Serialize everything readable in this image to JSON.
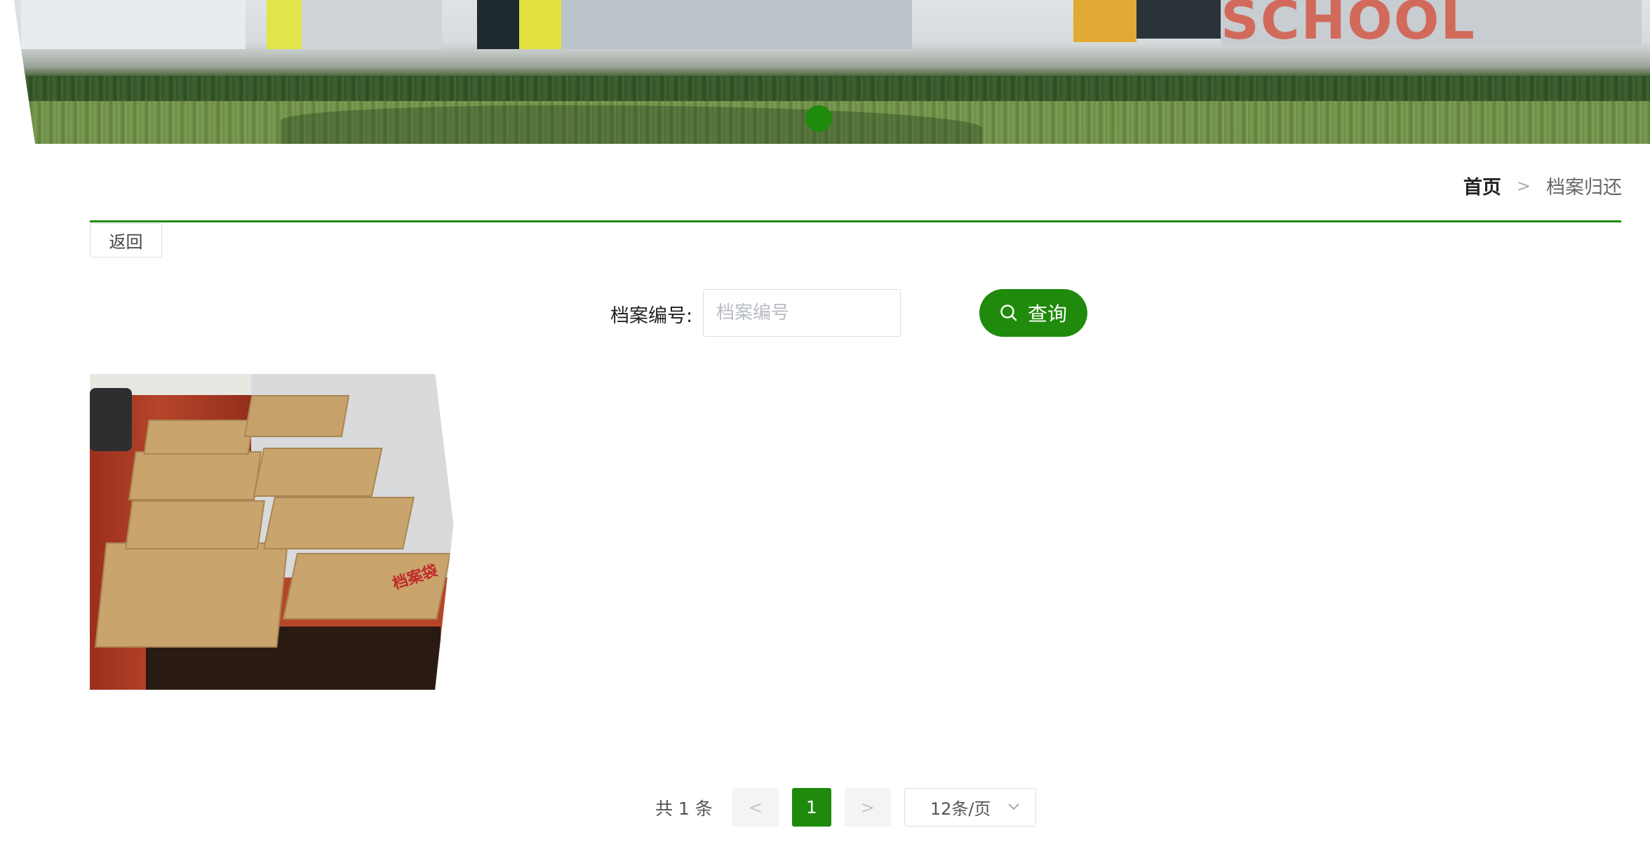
{
  "banner": {
    "sign_text": "SCHOOL",
    "active_slide": 1
  },
  "breadcrumb": {
    "home": "首页",
    "separator": ">",
    "current": "档案归还"
  },
  "toolbar": {
    "back_label": "返回"
  },
  "search": {
    "label": "档案编号:",
    "placeholder": "档案编号",
    "value": "",
    "button_label": "查询"
  },
  "cards": [
    {
      "image": "archive-folders-photo",
      "stamp_text": "档案袋"
    }
  ],
  "pagination": {
    "total_text": "共 1 条",
    "prev": "<",
    "current_page": "1",
    "next": ">",
    "page_size": "12条/页"
  },
  "colors": {
    "accent": "#1f8a0c",
    "rule": "#1f8a0c"
  },
  "icons": {
    "search": "search-icon",
    "dropdown": "chevron-down-icon"
  }
}
